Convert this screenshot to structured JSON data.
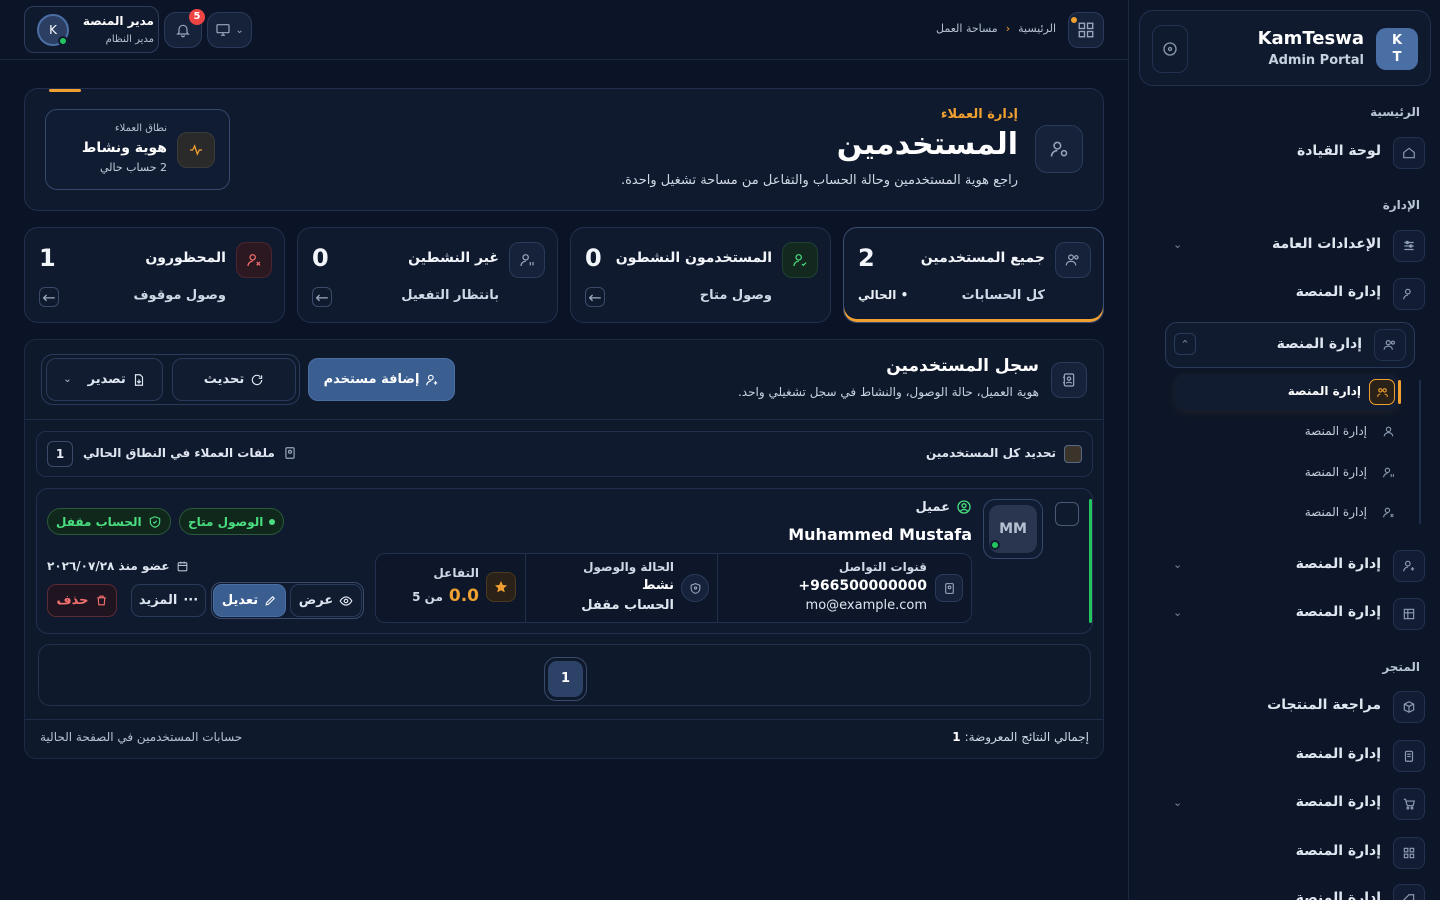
{
  "brand": {
    "initials_top": "K",
    "initials_bottom": "T",
    "name": "KamTeswa",
    "subtitle": "Admin Portal"
  },
  "sidebar": {
    "sections": {
      "home": "الرئيسية",
      "admin": "الإدارة",
      "store": "المتجر"
    },
    "items": [
      {
        "label": "لوحة القيادة",
        "icon": "home-icon"
      },
      {
        "label": "الإعدادات العامة",
        "icon": "sliders-icon"
      },
      {
        "label": "إدارة المنصة",
        "icon": "user-cog-icon"
      },
      {
        "label": "إدارة المنصة",
        "icon": "users-icon"
      },
      {
        "label": "إدارة المنصة",
        "icon": "user-plus-icon"
      },
      {
        "label": "إدارة المنصة",
        "icon": "building-icon"
      },
      {
        "label": "مراجعة المنتجات",
        "icon": "box-icon"
      },
      {
        "label": "إدارة المنصة",
        "icon": "clipboard-icon"
      },
      {
        "label": "إدارة المنصة",
        "icon": "cart-icon"
      },
      {
        "label": "إدارة المنصة",
        "icon": "grid-icon"
      },
      {
        "label": "إدارة المنصة",
        "icon": "tag-icon"
      }
    ],
    "subitems": [
      {
        "label": "إدارة المنصة",
        "active": true
      },
      {
        "label": "إدارة المنصة"
      },
      {
        "label": "إدارة المنصة"
      },
      {
        "label": "إدارة المنصة"
      }
    ]
  },
  "topbar": {
    "breadcrumb_home": "الرئيسية",
    "breadcrumb_current": "مساحة العمل",
    "user_name": "مدير المنصة",
    "user_role": "مدير النظام",
    "user_initial": "K",
    "notif_count": "5"
  },
  "hero": {
    "kicker": "إدارة العملاء",
    "title": "المستخدمين",
    "desc": "راجع هوية المستخدمين وحالة الحساب والتفاعل من مساحة تشغيل واحدة.",
    "scope_label": "نطاق العملاء",
    "scope_title": "هوية ونشاط",
    "scope_sub": "2 حساب حالي"
  },
  "stats": [
    {
      "title": "جميع المستخدمين",
      "value": "2",
      "sub": "كل الحسابات",
      "tag": "• الحالي",
      "color": "#9aa8be"
    },
    {
      "title": "المستخدمون النشطون",
      "value": "0",
      "sub": "وصول متاح",
      "color": "#4ade80"
    },
    {
      "title": "غير النشطين",
      "value": "0",
      "sub": "بانتظار التفعيل",
      "color": "#9aa8be"
    },
    {
      "title": "المحظورون",
      "value": "1",
      "sub": "وصول موقوف",
      "color": "#f87171"
    }
  ],
  "registry": {
    "title": "سجل المستخدمين",
    "desc": "هوية العميل، حالة الوصول، والنشاط في سجل تشغيلي واحد.",
    "add_btn": "إضافة مستخدم",
    "refresh_btn": "تحديث",
    "export_btn": "تصدير",
    "select_all": "تحديد كل المستخدمين",
    "files_label": "ملفات العملاء في النطاق الحالي",
    "files_count": "1"
  },
  "user": {
    "role": "عميل",
    "name": "Muhammed Mustafa",
    "initials": "MM",
    "access_badge": "الوصول متاح",
    "account_badge": "الحساب مقفل",
    "channels_label": "قنوات التواصل",
    "phone": "+966500000000",
    "email": "mo@example.com",
    "status_label": "الحالة والوصول",
    "status_value": "نشط",
    "status_account": "الحساب مقفل",
    "engagement_label": "التفاعل",
    "engagement_value": "0.0",
    "engagement_max": "من 5",
    "member_since": "عضو منذ ٢٠٢٦/٠٧/٢٨",
    "view_btn": "عرض",
    "edit_btn": "تعديل",
    "more_btn": "المزيد",
    "delete_btn": "حذف"
  },
  "pagination": {
    "current": "1"
  },
  "footer": {
    "total_label": "إجمالي النتائج المعروضة:",
    "total_value": "1",
    "note": "حسابات المستخدمين في الصفحة الحالية"
  },
  "colors": {
    "accent": "#f0a030",
    "primary": "#3b5e91",
    "success": "#4ade80",
    "danger": "#f87171"
  }
}
